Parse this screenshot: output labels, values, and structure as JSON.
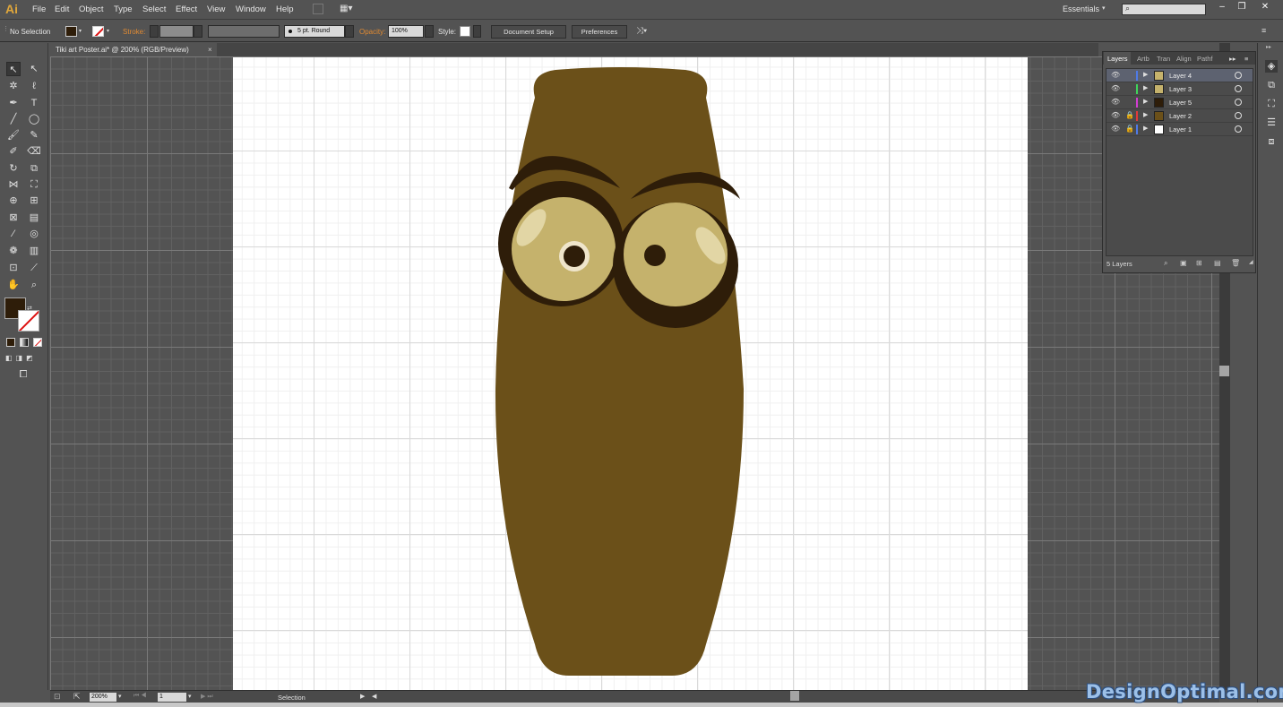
{
  "app": {
    "logo": "Ai",
    "menu": [
      "File",
      "Edit",
      "Object",
      "Type",
      "Select",
      "Effect",
      "View",
      "Window",
      "Help"
    ],
    "workspace": "Essentials",
    "window_controls": [
      "–",
      "❐",
      "✕"
    ]
  },
  "control_bar": {
    "selection_state": "No Selection",
    "stroke_label": "Stroke:",
    "brush": "5 pt. Round",
    "opacity_label": "Opacity:",
    "opacity_value": "100%",
    "style_label": "Style:",
    "document_setup": "Document Setup",
    "preferences": "Preferences"
  },
  "document": {
    "tab_title": "Tiki art Poster.ai* @ 200% (RGB/Preview)",
    "close_glyph": "×"
  },
  "status_bar": {
    "zoom": "200%",
    "artboard_number": "1",
    "tool_status": "Selection"
  },
  "layers_panel": {
    "tabs": [
      "Layers",
      "Artb",
      "Tran",
      "Align",
      "Pathf"
    ],
    "layers": [
      {
        "name": "Layer 4",
        "color": "#4f7ae6",
        "locked": false,
        "selected": true
      },
      {
        "name": "Layer 3",
        "color": "#3fd35a",
        "locked": false,
        "selected": false
      },
      {
        "name": "Layer 5",
        "color": "#d23ed2",
        "locked": false,
        "selected": false
      },
      {
        "name": "Layer 2",
        "color": "#e03a3a",
        "locked": true,
        "selected": false
      },
      {
        "name": "Layer 1",
        "color": "#4f7ae6",
        "locked": true,
        "selected": false
      }
    ],
    "count_label": "5 Layers"
  },
  "artwork": {
    "body_color": "#6b5019",
    "brow_color": "#2e1d09",
    "lens_color": "#c5b26c"
  },
  "colors": {
    "fill_swatch": "#2e1d09",
    "ui_gray": "#535353"
  },
  "watermark": "DesignOptimal.com"
}
